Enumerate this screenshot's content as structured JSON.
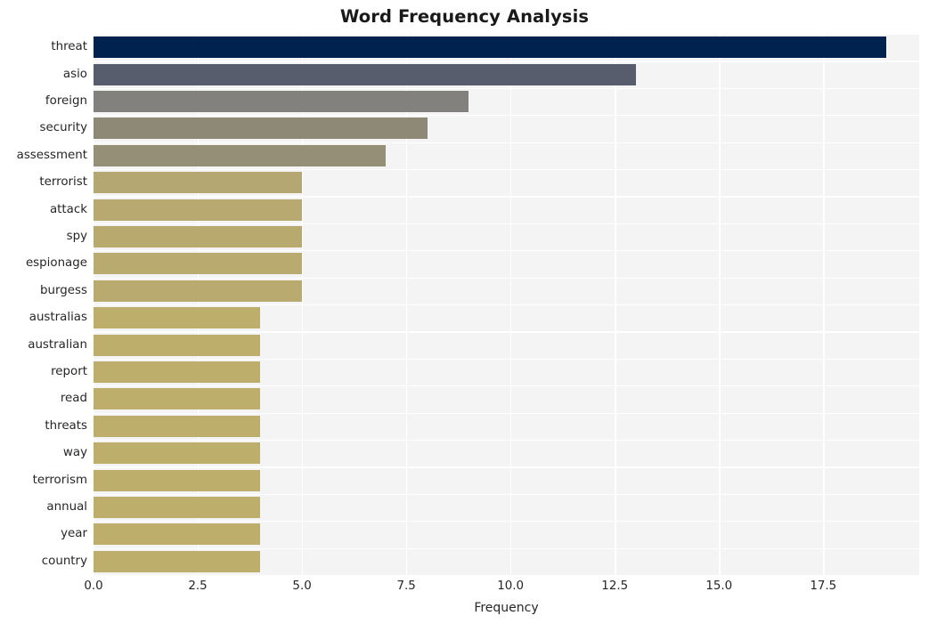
{
  "chart_data": {
    "type": "bar",
    "orientation": "horizontal",
    "title": "Word Frequency Analysis",
    "xlabel": "Frequency",
    "ylabel": "",
    "categories": [
      "threat",
      "asio",
      "foreign",
      "security",
      "assessment",
      "terrorist",
      "attack",
      "spy",
      "espionage",
      "burgess",
      "australias",
      "australian",
      "report",
      "read",
      "threats",
      "way",
      "terrorism",
      "annual",
      "year",
      "country"
    ],
    "values": [
      19,
      13,
      9,
      8,
      7,
      5,
      5,
      5,
      5,
      5,
      4,
      4,
      4,
      4,
      4,
      4,
      4,
      4,
      4,
      4
    ],
    "bar_colors": [
      "#00224e",
      "#575d6d",
      "#83817e",
      "#8e8977",
      "#958f78",
      "#b5a771",
      "#b7a970",
      "#b8aa6f",
      "#b9ab6f",
      "#b9ab6f",
      "#bdae6c",
      "#bdae6c",
      "#bdae6c",
      "#bdae6c",
      "#bdae6c",
      "#bdae6c",
      "#bdae6c",
      "#bdae6c",
      "#bdae6c",
      "#bdae6c"
    ],
    "xlim": [
      0,
      19.8
    ],
    "xticks": [
      "0.0",
      "2.5",
      "5.0",
      "7.5",
      "10.0",
      "12.5",
      "15.0",
      "17.5"
    ],
    "xtick_values": [
      0,
      2.5,
      5,
      7.5,
      10,
      12.5,
      15,
      17.5
    ],
    "grid": true,
    "legend": "none",
    "style": {
      "plot_background": "#f4f4f5",
      "grid_color": "#ffffff",
      "figure_background": "#ffffff",
      "text_color": "#262626"
    }
  }
}
